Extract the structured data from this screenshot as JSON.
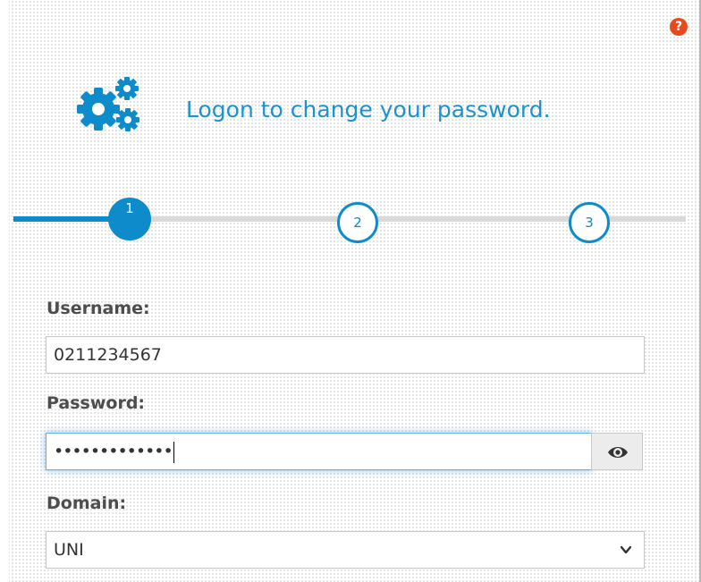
{
  "header": {
    "title": "Logon to change your password."
  },
  "icons": {
    "help": "question-circle-icon",
    "settings": "gears-icon",
    "reveal": "eye-icon",
    "dropdown": "chevron-down-icon"
  },
  "colors": {
    "accent": "#0d8bca",
    "title": "#1c93cf",
    "help": "#e8491d"
  },
  "help": {
    "symbol": "?"
  },
  "progress": {
    "current_step": 1,
    "steps": [
      {
        "label": "1"
      },
      {
        "label": "2"
      },
      {
        "label": "3"
      }
    ]
  },
  "form": {
    "username": {
      "label": "Username:",
      "value": "0211234567"
    },
    "password": {
      "label": "Password:",
      "masked_value": "•••••••••••••"
    },
    "domain": {
      "label": "Domain:",
      "selected": "UNI"
    }
  }
}
